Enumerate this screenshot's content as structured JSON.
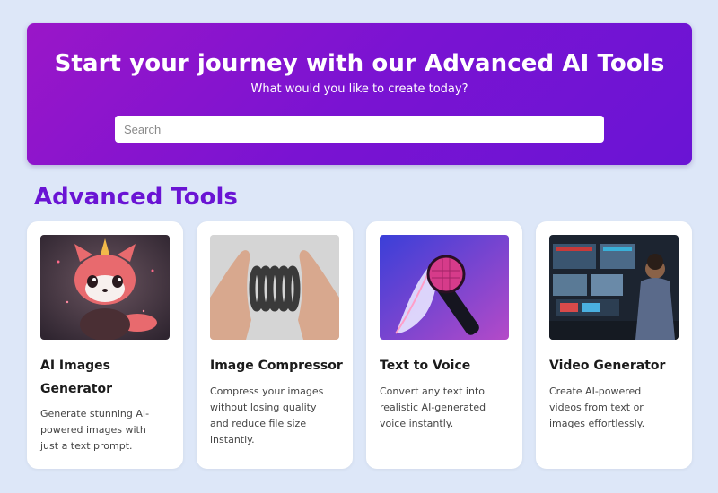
{
  "hero": {
    "title": "Start your journey with our Advanced AI Tools",
    "subtitle": "What would you like to create today?",
    "search_placeholder": "Search"
  },
  "section": {
    "title": "Advanced Tools"
  },
  "tools": [
    {
      "title": "AI Images Generator",
      "description": "Generate stunning AI-powered images with just a text prompt.",
      "image": "red-panda-illustration"
    },
    {
      "title": "Image Compressor",
      "description": "Compress your images without losing quality and reduce file size instantly.",
      "image": "hands-compressing-spring"
    },
    {
      "title": "Text to Voice",
      "description": "Convert any text into realistic AI-generated voice instantly.",
      "image": "microphone-with-feather"
    },
    {
      "title": "Video Generator",
      "description": "Create AI-powered videos from text or images effortlessly.",
      "image": "video-editing-workstation"
    }
  ],
  "colors": {
    "page_background": "#dde7f8",
    "hero_gradient_start": "#9a16c8",
    "hero_gradient_end": "#6a14d4",
    "section_title": "#6a14d4",
    "card_background": "#ffffff"
  }
}
